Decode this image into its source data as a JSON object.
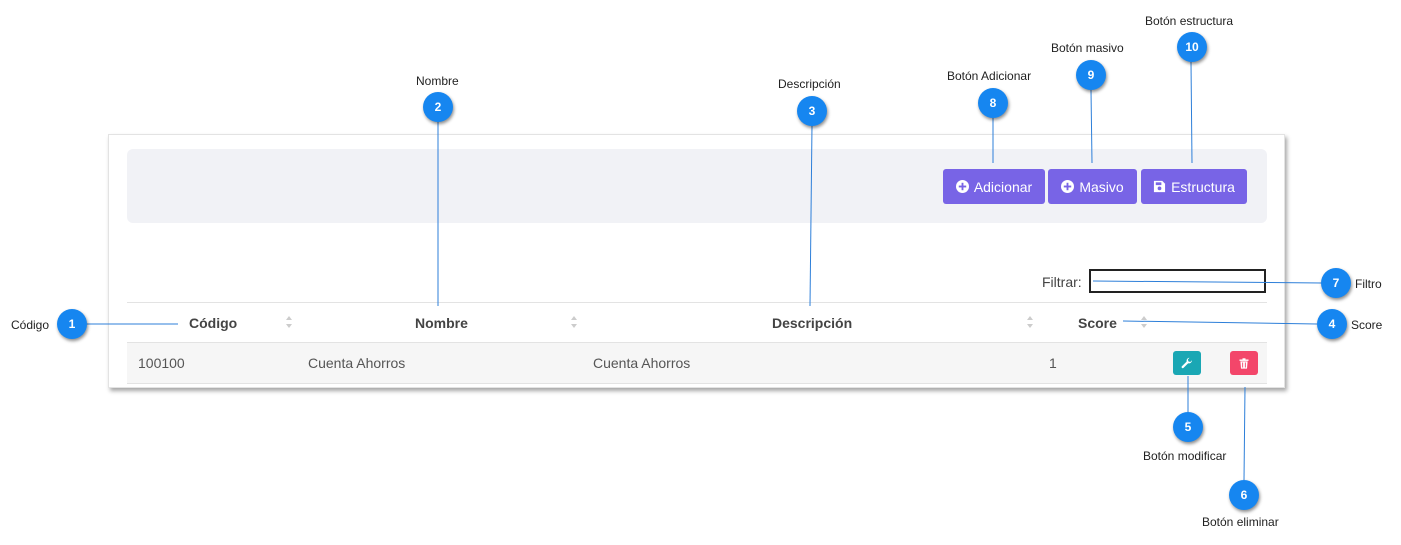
{
  "toolbar": {
    "add_label": "Adicionar",
    "bulk_label": "Masivo",
    "structure_label": "Estructura"
  },
  "filter": {
    "label": "Filtrar:",
    "value": ""
  },
  "table": {
    "columns": [
      "Código",
      "Nombre",
      "Descripción",
      "Score"
    ],
    "rows": [
      {
        "codigo": "100100",
        "nombre": "Cuenta Ahorros",
        "descripcion": "Cuenta Ahorros",
        "score": "1"
      }
    ]
  },
  "callouts": [
    {
      "number": "1",
      "label": "Código"
    },
    {
      "number": "2",
      "label": "Nombre"
    },
    {
      "number": "3",
      "label": "Descripción"
    },
    {
      "number": "4",
      "label": "Score"
    },
    {
      "number": "5",
      "label": "Botón modificar"
    },
    {
      "number": "6",
      "label": "Botón eliminar"
    },
    {
      "number": "7",
      "label": "Filtro"
    },
    {
      "number": "8",
      "label": "Botón Adicionar"
    },
    {
      "number": "9",
      "label": "Botón masivo"
    },
    {
      "number": "10",
      "label": "Botón estructura"
    }
  ],
  "colors": {
    "primary": "#7864e6",
    "edit": "#1aa7b4",
    "delete": "#f3466a",
    "callout": "#1686f0"
  }
}
